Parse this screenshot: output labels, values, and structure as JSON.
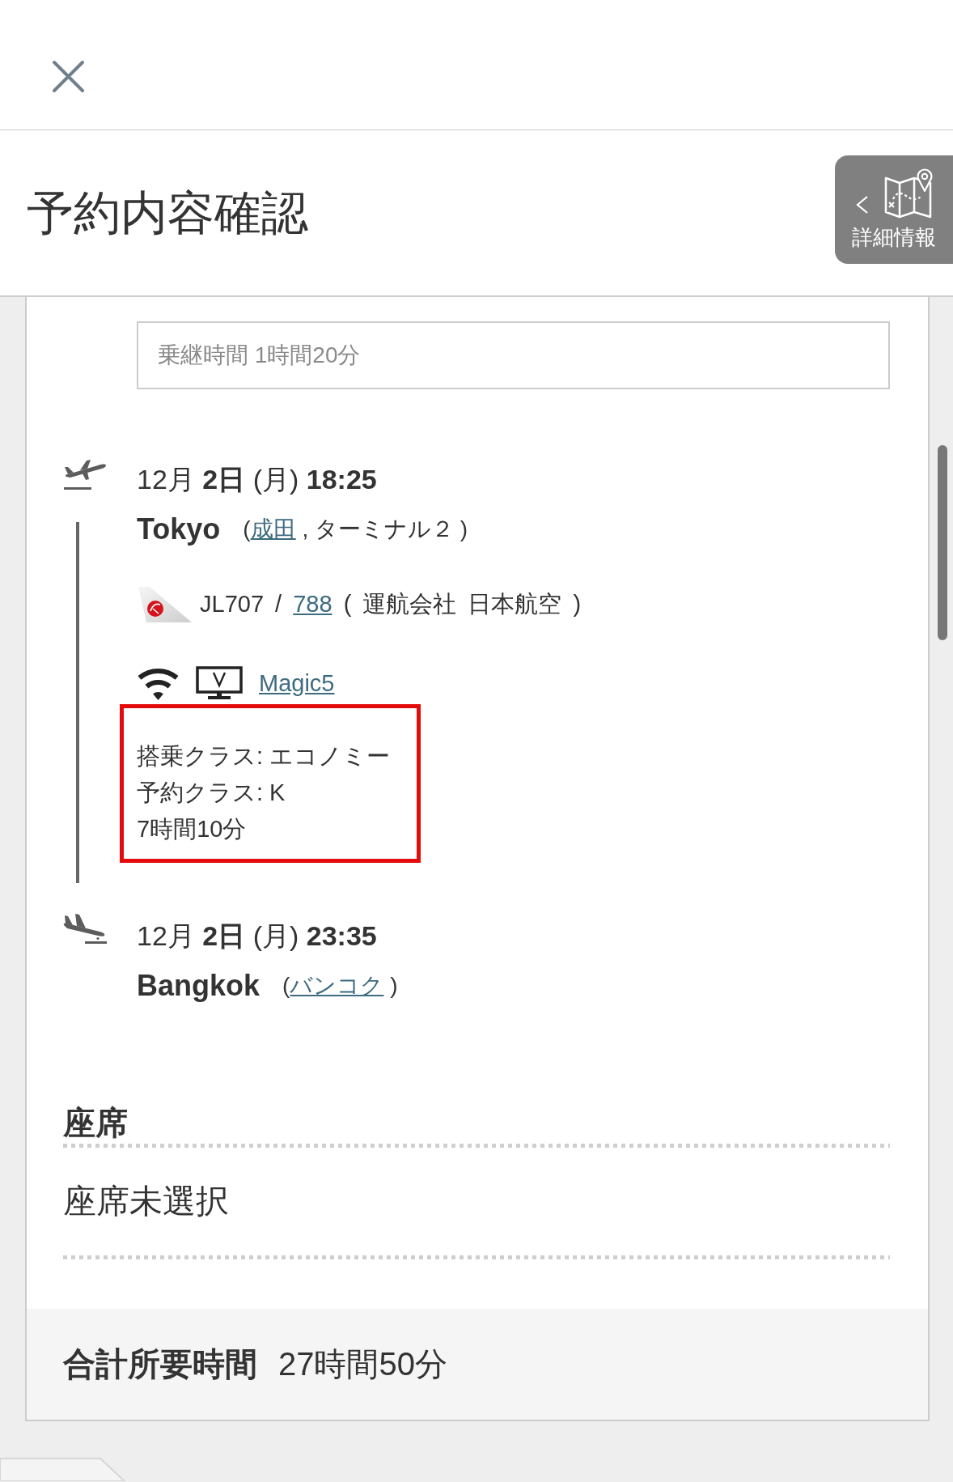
{
  "title": "予約内容確認",
  "details_button": {
    "label": "詳細情報"
  },
  "transfer": {
    "text": "乗継時間 1時間20分"
  },
  "departure": {
    "date": "12月 **2日** (月) **18:25**",
    "city": "Tokyo",
    "airport_open": "(",
    "airport": "成田",
    "airport_close": ", ターミナル２ )"
  },
  "flight": {
    "number": "JL707 /",
    "aircraft": "788",
    "operator": "( 運航会社 日本航空 )"
  },
  "amenities": [
    {
      "kind": "wifi"
    },
    {
      "kind": "video"
    }
  ],
  "entertainment": "Magic5",
  "details": {
    "highlighted": true,
    "lines": [
      "搭乗クラス: エコノミー",
      "予約クラス: K",
      "7時間10分"
    ]
  },
  "arrival": {
    "date": "12月 **2日** (月) **23:35**",
    "city": "Bangkok",
    "airport_open": "(",
    "airport": "バンコク",
    "airport_close": ")"
  },
  "seat": {
    "heading": "座席",
    "value": "座席未選択"
  },
  "total": {
    "label": "合計所要時間",
    "value": "27時間50分"
  }
}
